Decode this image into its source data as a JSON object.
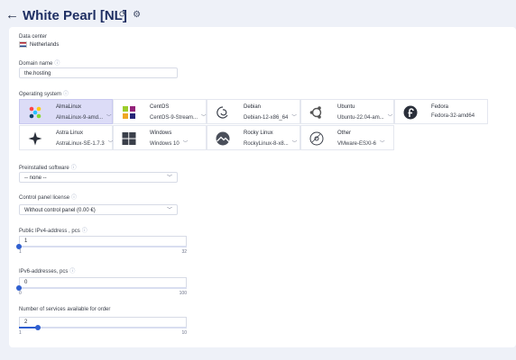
{
  "header": {
    "back_icon": "arrow-left-icon",
    "title": "White Pearl [NL]",
    "icons": [
      "refresh-icon",
      "gear-icon"
    ]
  },
  "datacenter": {
    "label": "Data center",
    "value": "Netherlands",
    "flag_icon": "flag-nl-icon"
  },
  "domain": {
    "label": "Domain name",
    "value": "the.hosting"
  },
  "os": {
    "label": "Operating system",
    "items": [
      {
        "name": "AlmaLinux",
        "version": "AlmaLinux-9-amd...",
        "icon": "almalinux-icon",
        "selected": true,
        "dropdown": true
      },
      {
        "name": "CentOS",
        "version": "CentOS-9-Stream...",
        "icon": "centos-icon",
        "selected": false,
        "dropdown": true
      },
      {
        "name": "Debian",
        "version": "Debian-12-x86_64",
        "icon": "debian-icon",
        "selected": false,
        "dropdown": true
      },
      {
        "name": "Ubuntu",
        "version": "Ubuntu-22.04-am...",
        "icon": "ubuntu-icon",
        "selected": false,
        "dropdown": true
      },
      {
        "name": "Fedora",
        "version": "Fedora-32-amd64",
        "icon": "fedora-icon",
        "selected": false,
        "dropdown": false
      },
      {
        "name": "Astra Linux",
        "version": "AstraLinux-SE-1.7.3",
        "icon": "astra-linux-icon",
        "selected": false,
        "dropdown": true
      },
      {
        "name": "Windows",
        "version": "Windows 10",
        "icon": "windows-icon",
        "selected": false,
        "dropdown": true
      },
      {
        "name": "Rocky Linux",
        "version": "RockyLinux-8-x8...",
        "icon": "rocky-linux-icon",
        "selected": false,
        "dropdown": true
      },
      {
        "name": "Other",
        "version": "VMware-ESXI-6",
        "icon": "disc-icon",
        "selected": false,
        "dropdown": true
      }
    ]
  },
  "software": {
    "label": "Preinstalled software",
    "value": "-- none --"
  },
  "panel": {
    "label": "Control panel license",
    "value": "Without control panel (0.00 €)"
  },
  "ipv4": {
    "label": "Public IPv4-address , pcs",
    "value": "1",
    "min": "1",
    "max": "32",
    "fraction": 0
  },
  "ipv6": {
    "label": "IPv6-addresses, pcs",
    "value": "0",
    "min": "0",
    "max": "100",
    "fraction": 0
  },
  "services": {
    "label": "Number of services available for order",
    "value": "2",
    "min": "1",
    "max": "10",
    "fraction": 0.111
  },
  "colors": {
    "accent": "#2f5fd0",
    "selected_tile": "#dcdcf7",
    "title": "#1f2f63",
    "background": "#eef1f8"
  }
}
